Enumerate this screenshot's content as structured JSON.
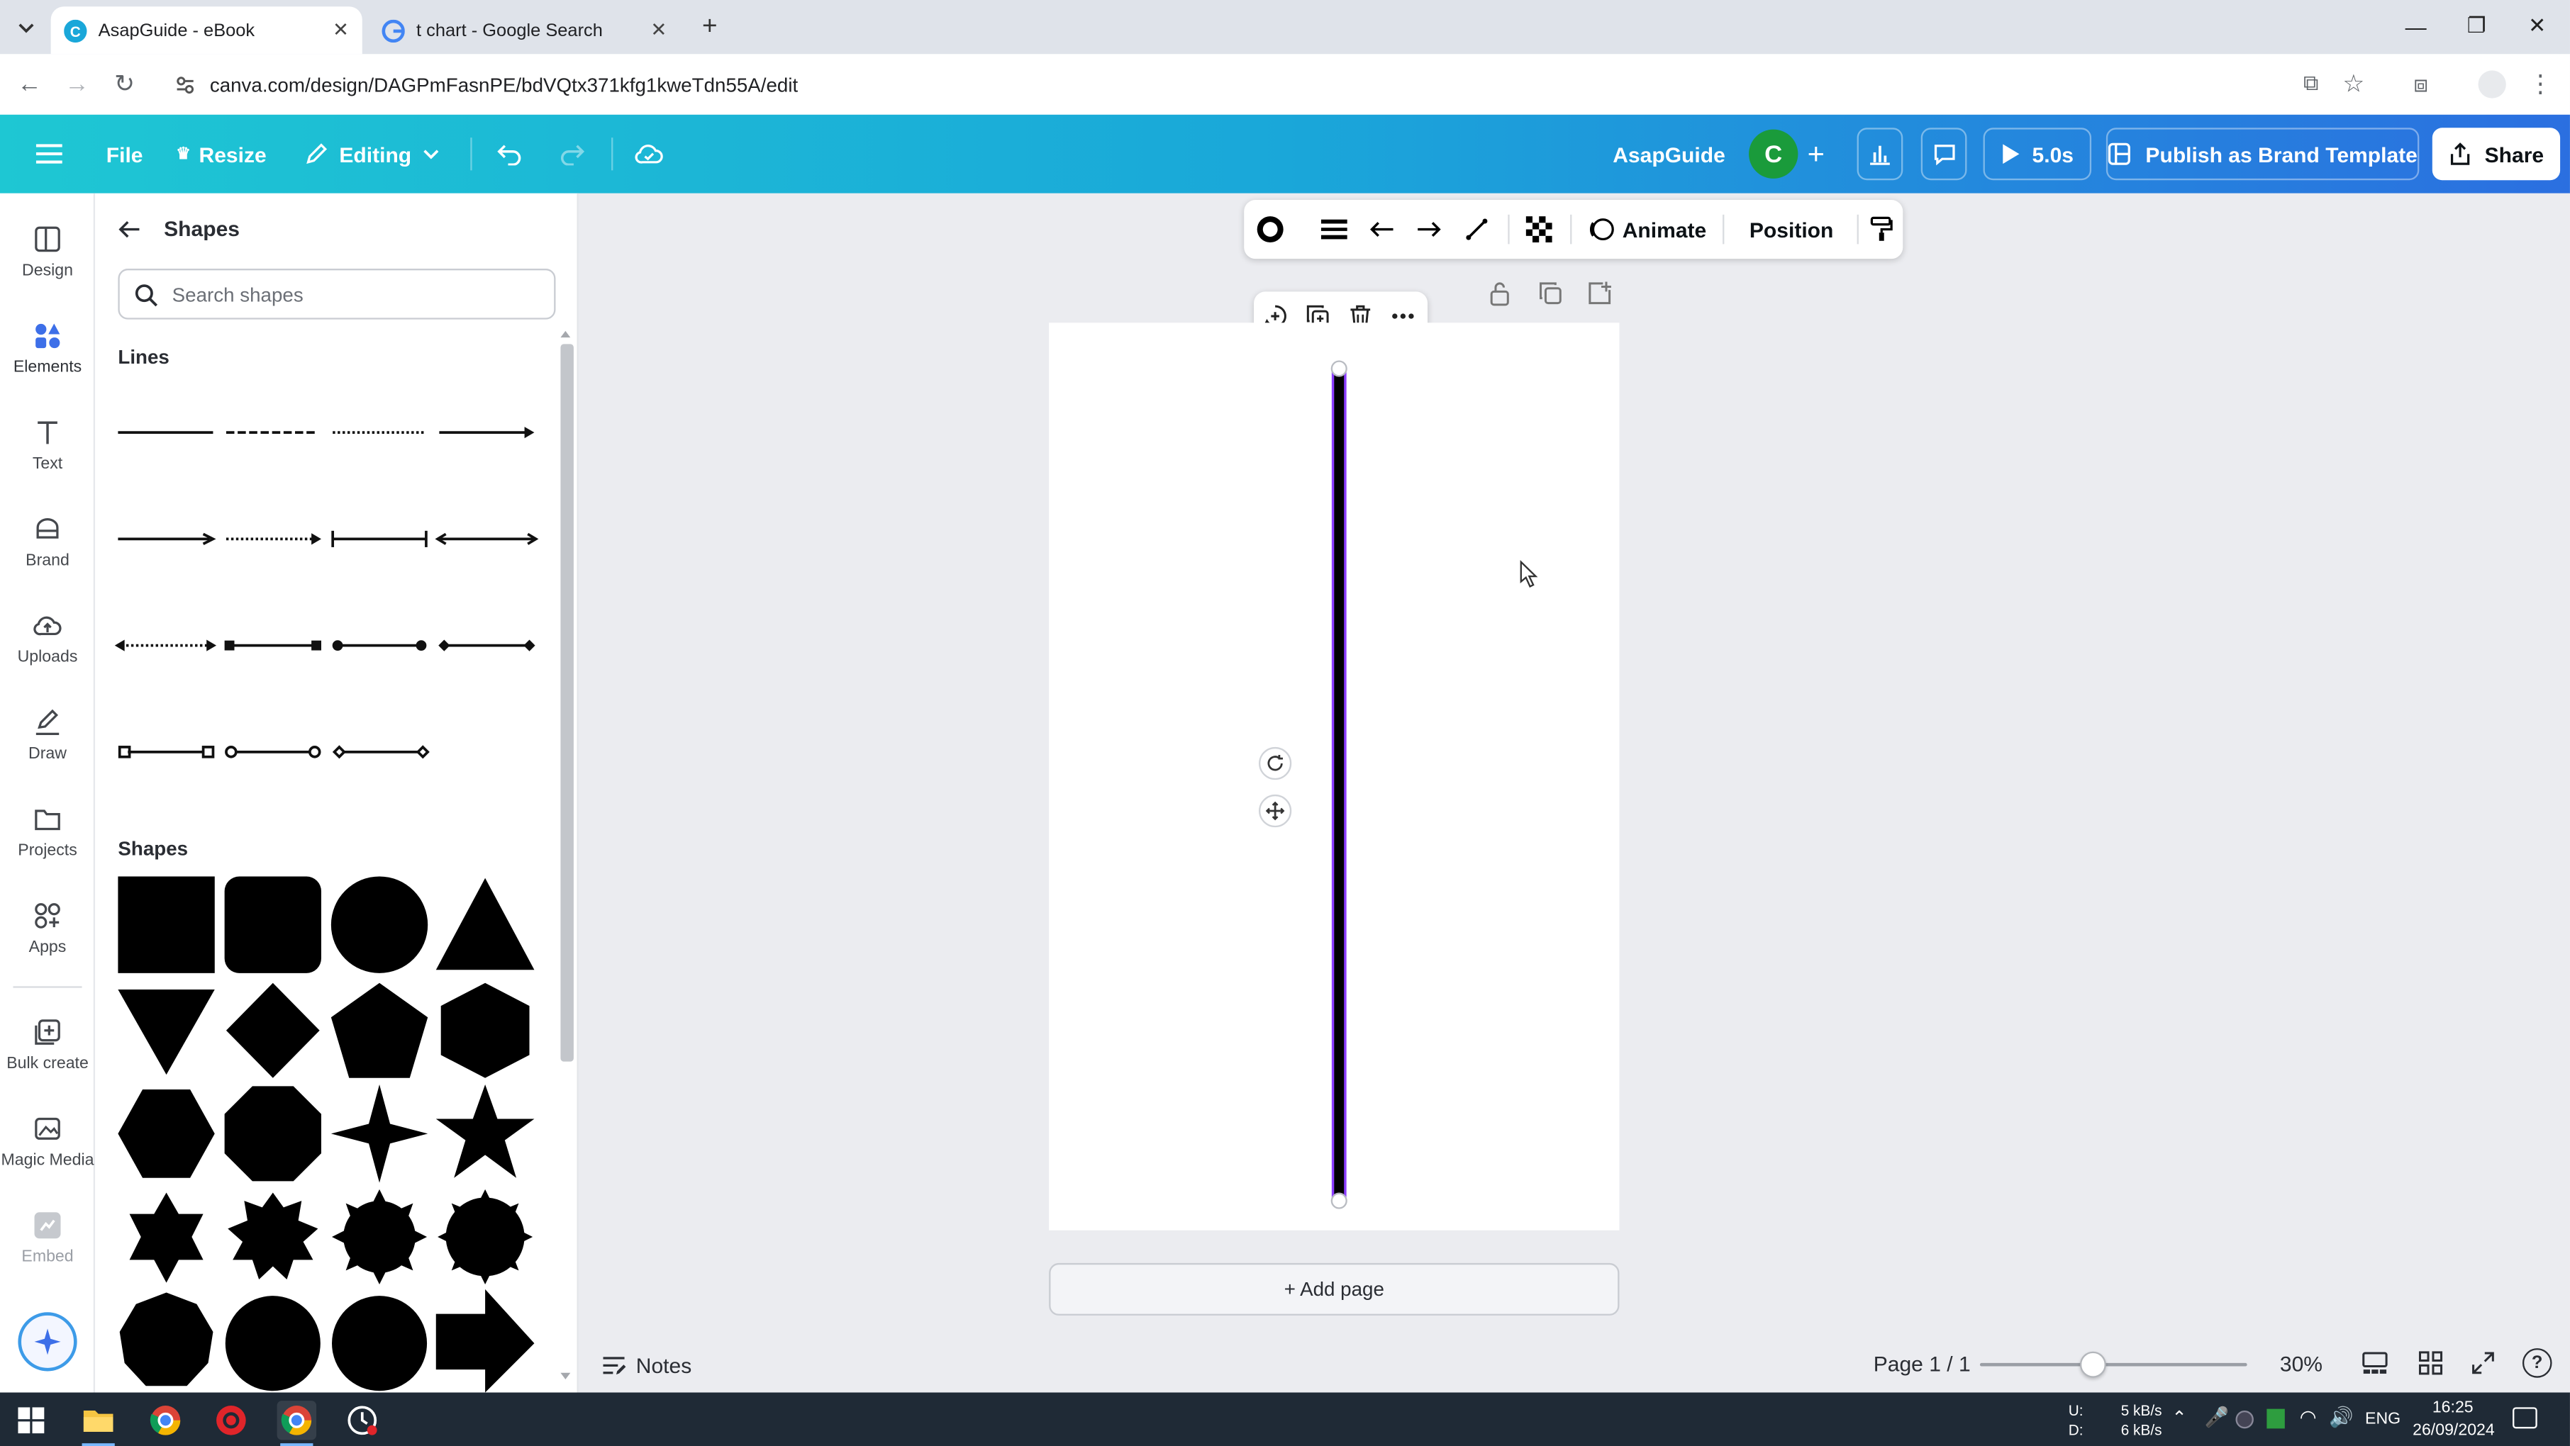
{
  "browser": {
    "tabs": [
      {
        "title": "AsapGuide - eBook",
        "active": true
      },
      {
        "title": "t chart - Google Search",
        "active": false
      }
    ],
    "url": "canva.com/design/DAGPmFasnPE/bdVQtx371kfg1kweTdn55A/edit"
  },
  "topbar": {
    "file": "File",
    "resize": "Resize",
    "editing": "Editing",
    "doc_title": "AsapGuide",
    "avatar_letter": "C",
    "timer": "5.0s",
    "publish": "Publish as Brand Template",
    "share": "Share"
  },
  "rail": [
    {
      "label": "Design",
      "icon": "design-icon"
    },
    {
      "label": "Elements",
      "icon": "elements-icon"
    },
    {
      "label": "Text",
      "icon": "text-icon"
    },
    {
      "label": "Brand",
      "icon": "brand-icon"
    },
    {
      "label": "Uploads",
      "icon": "uploads-icon"
    },
    {
      "label": "Draw",
      "icon": "draw-icon"
    },
    {
      "label": "Projects",
      "icon": "projects-icon"
    },
    {
      "label": "Apps",
      "icon": "apps-icon"
    },
    {
      "label": "Bulk create",
      "icon": "bulk-create-icon"
    },
    {
      "label": "Magic Media",
      "icon": "magic-media-icon"
    },
    {
      "label": "Embed",
      "icon": "embed-icon"
    }
  ],
  "panel": {
    "title": "Shapes",
    "search_placeholder": "Search shapes",
    "lines_heading": "Lines",
    "shapes_heading": "Shapes"
  },
  "context_toolbar": {
    "animate": "Animate",
    "position": "Position"
  },
  "canvas": {
    "add_page": "+ Add page"
  },
  "bottom": {
    "notes": "Notes",
    "page_indicator": "Page 1 / 1",
    "zoom": "30%",
    "zoom_level": 0.3
  },
  "taskbar": {
    "net_up_label": "U:",
    "net_down_label": "D:",
    "net_up": "5 kB/s",
    "net_down": "6 kB/s",
    "lang": "ENG",
    "time": "16:25",
    "date": "26/09/2024"
  },
  "colors": {
    "canva_teal": "#1ec7d3",
    "canva_blue": "#2b6fe0",
    "selection_purple": "#8b3dff",
    "avatar_green": "#1a9b3b"
  }
}
